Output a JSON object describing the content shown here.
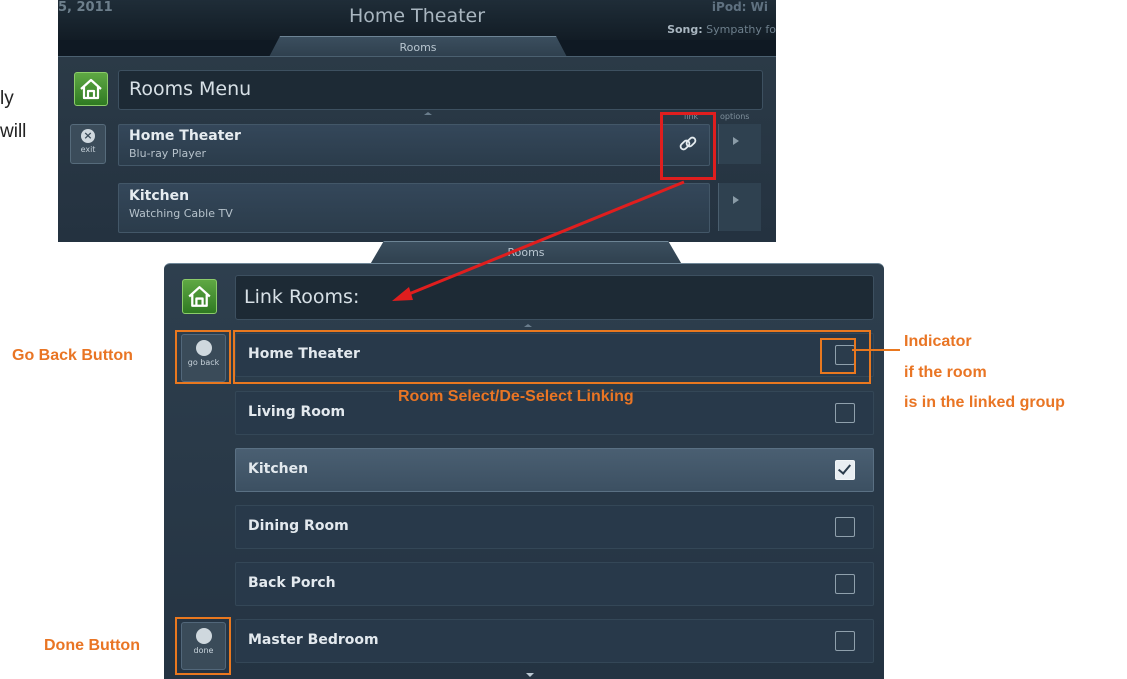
{
  "side_text": {
    "line1": "ly",
    "line2": "will"
  },
  "top_screen": {
    "date": "5, 2011",
    "window_title": "Home Theater",
    "ipod_label": "iPod: Wi",
    "song_label": "Song:",
    "song_value": "Sympathy fo",
    "tab": "Rooms",
    "menu_title": "Rooms Menu",
    "col_link": "link",
    "col_options": "options",
    "exit_label": "exit",
    "rooms": [
      {
        "name": "Home Theater",
        "status": "Blu-ray Player"
      },
      {
        "name": "Kitchen",
        "status": "Watching Cable TV"
      }
    ]
  },
  "bottom_screen": {
    "tab": "Rooms",
    "title": "Link Rooms:",
    "go_back_label": "go back",
    "done_label": "done",
    "rooms": [
      {
        "name": "Home Theater",
        "checked": false
      },
      {
        "name": "Living Room",
        "checked": false
      },
      {
        "name": "Kitchen",
        "checked": true
      },
      {
        "name": "Dining Room",
        "checked": false
      },
      {
        "name": "Back Porch",
        "checked": false
      },
      {
        "name": "Master Bedroom",
        "checked": false
      }
    ]
  },
  "annotations": {
    "go_back_button": "Go Back Button",
    "done_button": "Done Button",
    "room_select": "Room Select/De-Select Linking",
    "indicator_line1": "Indicator",
    "indicator_line2": "if the room",
    "indicator_line3": "is in the linked group"
  },
  "colors": {
    "annotation": "#e97524",
    "highlight": "#e01e1e",
    "home_button": "#3e8e2e"
  }
}
